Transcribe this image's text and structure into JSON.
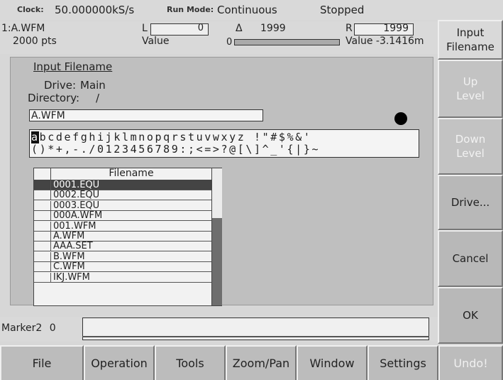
{
  "status": {
    "clock_label": "Clock:",
    "clock_value": "50.000000kS/s",
    "runmode_label": "Run Mode:",
    "runmode_value": "Continuous",
    "state": "Stopped"
  },
  "waveform": {
    "name": "1:A.WFM",
    "points": "2000 pts",
    "L_label": "L",
    "L_value": "0",
    "value_label": "Value",
    "value_zero": "0",
    "delta_label": "Δ",
    "delta_value": "1999",
    "R_label": "R",
    "R_value": "1999",
    "R_value_text": "Value -3.1416m"
  },
  "dialog": {
    "title": "Input Filename",
    "drive_label": "Drive:",
    "drive_value": "Main",
    "dir_label": "Directory:",
    "dir_value": "/",
    "filename_value": "A.WFM",
    "charset_row1_selected": "a",
    "charset_row1": "bcdefghijklmnopqrstuvwxyz !\"#$%&'",
    "charset_row2": "()*+,-./0123456789:;<=>?@[\\]^_'{|}~",
    "file_header": "Filename",
    "files": [
      "0001.EQU",
      "0002.EQU",
      "0003.EQU",
      "000A.WFM",
      "001.WFM",
      "A.WFM",
      "AAA.SET",
      "B.WFM",
      "C.WFM",
      "IKJ.WFM"
    ],
    "selected_index": 0
  },
  "marker": {
    "label": "Marker2",
    "value": "0"
  },
  "side_buttons": {
    "input_filename_1": "Input",
    "input_filename_2": "Filename",
    "up_level_1": "Up",
    "up_level_2": "Level",
    "down_level_1": "Down",
    "down_level_2": "Level",
    "drive": "Drive...",
    "cancel": "Cancel",
    "ok": "OK"
  },
  "bottom_menu": {
    "file": "File",
    "operation": "Operation",
    "tools": "Tools",
    "zoom_pan": "Zoom/Pan",
    "window": "Window",
    "settings": "Settings",
    "undo": "Undo!"
  }
}
